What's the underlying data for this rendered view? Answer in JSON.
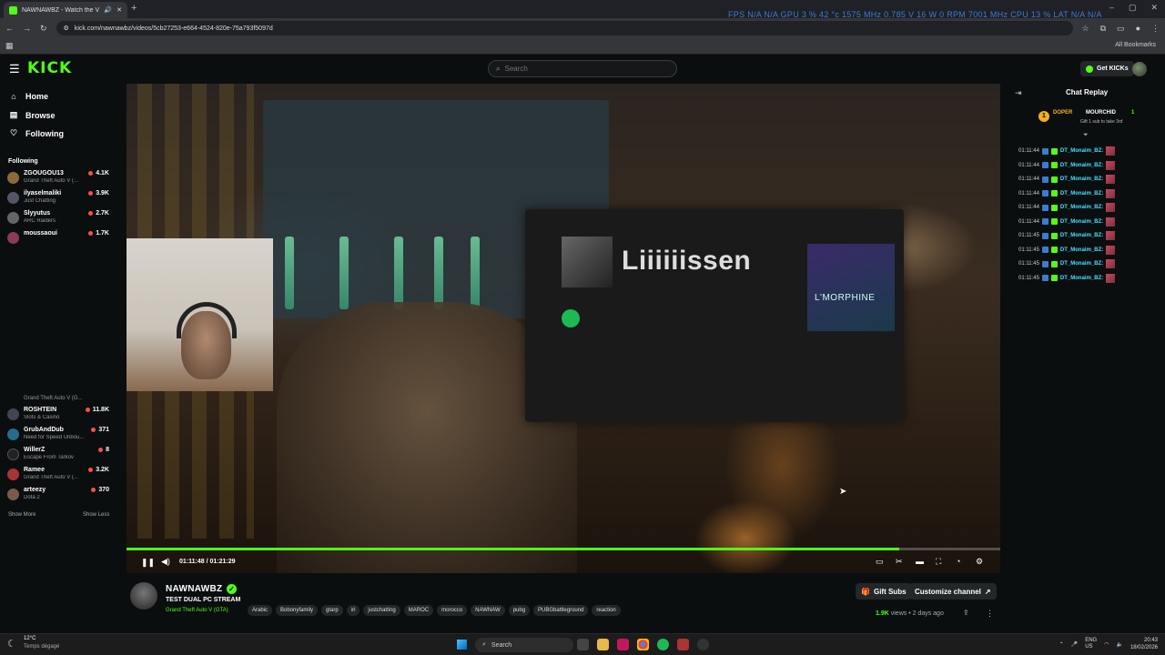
{
  "browser": {
    "tab_title": "NAWNAWBZ - Watch the V",
    "new_tab": "+",
    "overlay_stats": "FPS  N/A  N/A    GPU  3 %  42 °c  1575 MHz  0.785 V  16 W  0 RPM  7001 MHz    CPU  13 %    LAT  N/A  N/A",
    "url": "kick.com/nawnawbz/videos/5cb27253-e664-4524-820e-75a793f5097d",
    "all_bookmarks": "All Bookmarks"
  },
  "header": {
    "logo": "KICK",
    "search_placeholder": "Search",
    "get_kicks": "Get KICKs"
  },
  "sidebar": {
    "nav": [
      {
        "label": "Home",
        "icon": "home-icon"
      },
      {
        "label": "Browse",
        "icon": "browse-icon"
      },
      {
        "label": "Following",
        "icon": "heart-icon"
      }
    ],
    "following_title": "Following",
    "channels_top": [
      {
        "name": "ZGOUGOU13",
        "game": "Grand Theft Auto V (...",
        "viewers": "4.1K"
      },
      {
        "name": "ilyaselmaliki",
        "game": "Just Chatting",
        "viewers": "3.9K"
      },
      {
        "name": "Slyyutus",
        "game": "ARC Raiders",
        "viewers": "2.7K"
      },
      {
        "name": "moussaoui",
        "game": "",
        "viewers": "1.7K"
      }
    ],
    "channels_bottom_partial": "Grand Theft Auto V (G...",
    "channels_bottom": [
      {
        "name": "ROSHTEIN",
        "game": "Slots & Casino",
        "viewers": "11.8K"
      },
      {
        "name": "GrubAndDub",
        "game": "Need for Speed Unbou...",
        "viewers": "371"
      },
      {
        "name": "WillerZ",
        "game": "Escape From Tarkov",
        "viewers": "8"
      },
      {
        "name": "Ramee",
        "game": "Grand Theft Auto V (...",
        "viewers": "3.2K"
      },
      {
        "name": "arteezy",
        "game": "Dota 2",
        "viewers": "370"
      }
    ],
    "show_more": "Show More",
    "show_less": "Show Less"
  },
  "video": {
    "spotify_title": "Liiiiiissen",
    "album_text": "L'MORPHINE",
    "time": "01:11:48 / 01:21:29",
    "progress": 0.884
  },
  "chat": {
    "title": "Chat Replay",
    "pinned": {
      "badge": "1",
      "user1": "DOPER",
      "user2": "MOURCHID",
      "count": "1",
      "subtitle": "Gift 1 sub to take 3rd"
    },
    "messages": [
      {
        "time": "01:11:44",
        "user": "DT_Monaim_BZ:"
      },
      {
        "time": "01:11:44",
        "user": "DT_Monaim_BZ:"
      },
      {
        "time": "01:11:44",
        "user": "DT_Monaim_BZ:"
      },
      {
        "time": "01:11:44",
        "user": "DT_Monaim_BZ:"
      },
      {
        "time": "01:11:44",
        "user": "DT_Monaim_BZ:"
      },
      {
        "time": "01:11:44",
        "user": "DT_Monaim_BZ:"
      },
      {
        "time": "01:11:45",
        "user": "DT_Monaim_BZ:"
      },
      {
        "time": "01:11:45",
        "user": "DT_Monaim_BZ:"
      },
      {
        "time": "01:11:45",
        "user": "DT_Monaim_BZ:"
      },
      {
        "time": "01:11:45",
        "user": "DT_Monaim_BZ:"
      }
    ]
  },
  "channel": {
    "name": "NAWNAWBZ",
    "stream_title": "TEST DUAL PC STREAM",
    "category": "Grand Theft Auto V (GTA)",
    "tags": [
      "Arabic",
      "Bobonyfamily",
      "gtarp",
      "irl",
      "justchatting",
      "MAROC",
      "morocco",
      "NAWNAW",
      "pubg",
      "PUBGbattleground",
      "reaction"
    ],
    "gift_subs": "Gift Subs",
    "customize": "Customize channel",
    "views_count": "1.9K",
    "views_rest": " views  •  2 days ago"
  },
  "taskbar": {
    "temp": "12°C",
    "weather": "Temps dégagé",
    "search": "Search",
    "lang": "ENG\nUS",
    "time": "20:43",
    "date": "18/02/2026"
  },
  "colors": {
    "kick_green": "#53fc18",
    "background": "#0b0e0f",
    "chat_user": "#44e0ff"
  }
}
